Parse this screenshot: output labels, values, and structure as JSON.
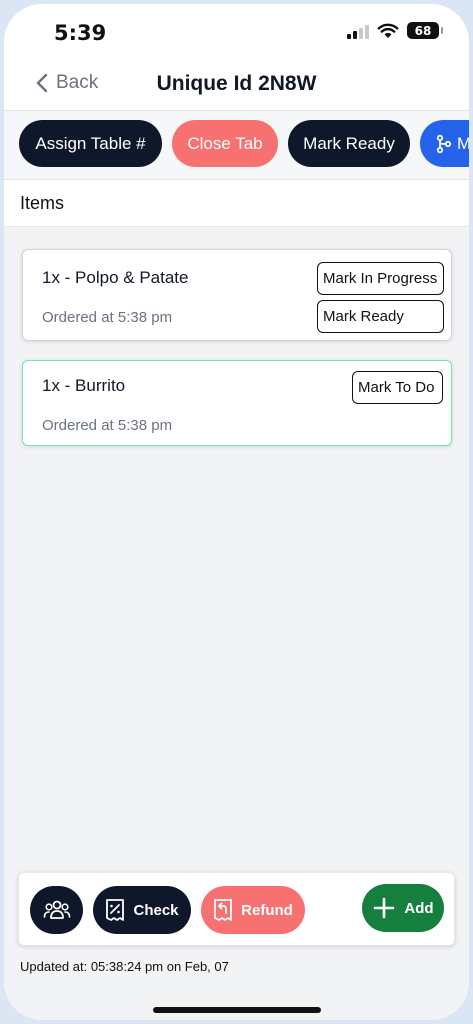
{
  "status_bar": {
    "time": "5:39",
    "battery": "68"
  },
  "nav": {
    "back_label": "Back",
    "title": "Unique Id 2N8W"
  },
  "actions": [
    {
      "label": "Assign Table #",
      "style": "dark"
    },
    {
      "label": "Close Tab",
      "style": "red"
    },
    {
      "label": "Mark Ready",
      "style": "dark"
    },
    {
      "label": "M",
      "style": "blue"
    }
  ],
  "items_section": {
    "title": "Items"
  },
  "items": [
    {
      "name": "1x - Polpo & Patate",
      "ordered": "Ordered at 5:38 pm",
      "buttons": [
        "Mark In Progress",
        "Mark Ready"
      ]
    },
    {
      "name": "1x - Burrito",
      "ordered": "Ordered at 5:38 pm",
      "buttons": [
        "Mark To Do"
      ]
    }
  ],
  "bottom_bar": {
    "check_label": "Check",
    "refund_label": "Refund",
    "add_label": "Add"
  },
  "footer": {
    "updated": "Updated at: 05:38:24 pm on Feb, 07"
  },
  "colors": {
    "dark": "#0f172a",
    "red": "#f87171",
    "blue": "#2563eb",
    "green": "#15803d",
    "card_border_green": "#6ee7a2"
  }
}
